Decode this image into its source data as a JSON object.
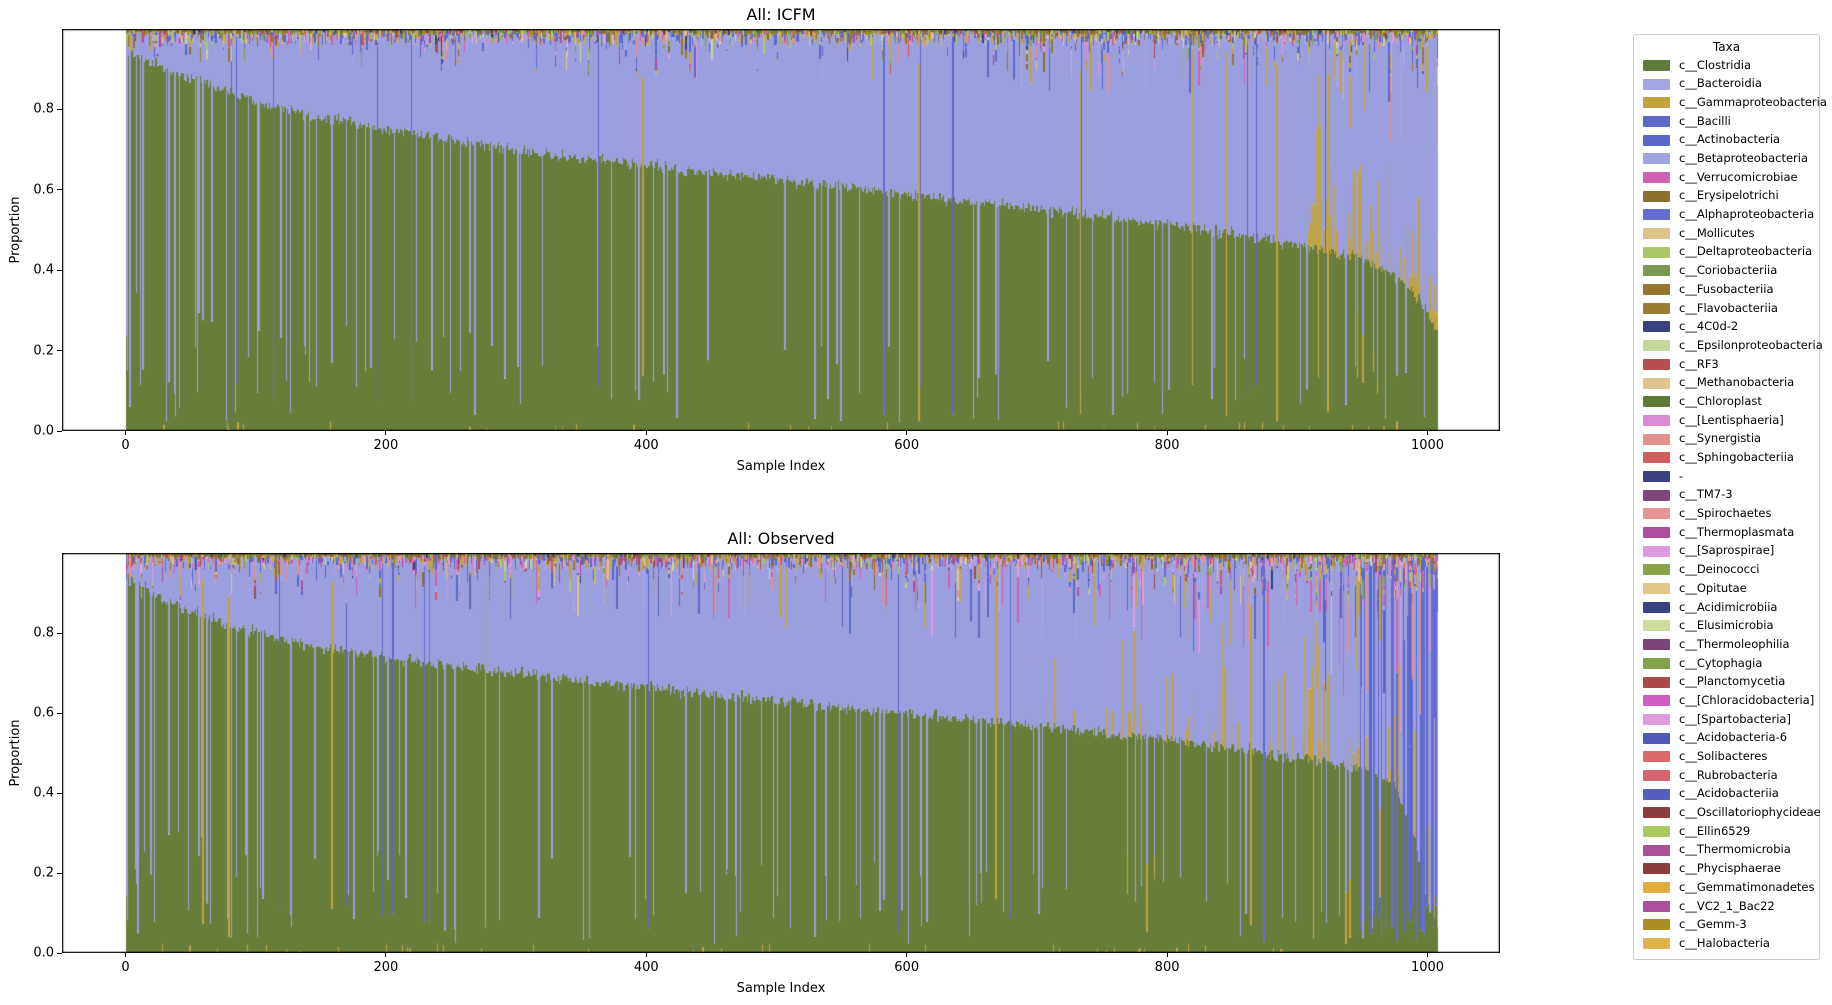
{
  "page": {
    "background": "#ffffff"
  },
  "chart_data": [
    {
      "type": "bar",
      "stacked": true,
      "title": "All: ICFM",
      "xlabel": "Sample Index",
      "ylabel": "Proportion",
      "xticks": [
        0,
        200,
        400,
        600,
        800,
        1000
      ],
      "yticks": [
        "0.0",
        "0.2",
        "0.4",
        "0.6",
        "0.8"
      ],
      "xlim": [
        -48,
        1056
      ],
      "ylim": [
        0,
        1
      ],
      "n_samples": 1008,
      "grid": false,
      "legend_position": "outside-right",
      "description": "Stacked taxa proportion bars per sample, sorted by decreasing c__Clostridia proportion; c__Bacteroidia fills most of the remainder up to ~0.97 with a noisy multi-taxa band at the top and scattered Bacteroidia/Gammaproteobacteria/Bacilli dominated outlier samples.",
      "dominant_series": [
        {
          "name": "c__Clostridia",
          "color": "#697d3b",
          "boundary_x": [
            0,
            10,
            30,
            60,
            100,
            150,
            200,
            300,
            400,
            500,
            600,
            700,
            800,
            900,
            950,
            980,
            1000,
            1007
          ],
          "boundary_y": [
            0.96,
            0.93,
            0.9,
            0.865,
            0.82,
            0.78,
            0.75,
            0.7,
            0.66,
            0.625,
            0.59,
            0.555,
            0.515,
            0.465,
            0.43,
            0.38,
            0.3,
            0.25
          ]
        },
        {
          "name": "c__Bacteroidia",
          "color": "#9c9fde",
          "top_boundary_mean": 0.965
        }
      ],
      "render_hints": {
        "seed": 101,
        "pink_weight": 1.0,
        "purple_outlier_base": 0.045,
        "purple_outlier_slope": 0.03,
        "gold_bar_p": 0.008,
        "blue_bar_p": 0.01,
        "blue_end_p": 0.03,
        "hang_p0": 0.2,
        "hang_p1": 0.15,
        "depth0": 0.05,
        "depth1": 0.1,
        "deep_t": 0.88,
        "depth_extra": 1.3,
        "gold_mid_t": 0.9,
        "gold_mid_p": 0.22,
        "left_cluster_n": 14,
        "left_cluster_p": 0.5
      }
    },
    {
      "type": "bar",
      "stacked": true,
      "title": "All: Observed",
      "xlabel": "Sample Index",
      "ylabel": "Proportion",
      "xticks": [
        0,
        200,
        400,
        600,
        800,
        1000
      ],
      "yticks": [
        "0.0",
        "0.2",
        "0.4",
        "0.6",
        "0.8"
      ],
      "xlim": [
        -48,
        1056
      ],
      "ylim": [
        0,
        1
      ],
      "n_samples": 1008,
      "grid": false,
      "legend_position": "outside-right",
      "description": "Observed stacked taxa proportions per sample, sorted by decreasing c__Clostridia; noisier than ICFM with more pink/magenta (Verrucomicrobiae, [Saprospirae], Thermoplasmata) streaks in the top band; Clostridia collapses to near zero for the last ~20 samples where Bacilli/Bacteroidia/Gammaproteobacteria dominate.",
      "dominant_series": [
        {
          "name": "c__Clostridia",
          "color": "#697d3b",
          "boundary_x": [
            0,
            10,
            30,
            60,
            100,
            150,
            200,
            300,
            400,
            500,
            600,
            700,
            800,
            900,
            950,
            975,
            990,
            1000,
            1007
          ],
          "boundary_y": [
            0.96,
            0.92,
            0.88,
            0.84,
            0.8,
            0.765,
            0.74,
            0.7,
            0.665,
            0.63,
            0.6,
            0.57,
            0.535,
            0.49,
            0.46,
            0.42,
            0.28,
            0.12,
            0.06
          ]
        },
        {
          "name": "c__Bacteroidia",
          "color": "#9c9fde",
          "top_boundary_mean": 0.955
        }
      ],
      "render_hints": {
        "seed": 202,
        "pink_weight": 2.4,
        "purple_outlier_base": 0.05,
        "purple_outlier_slope": 0.05,
        "gold_bar_p": 0.009,
        "blue_bar_p": 0.012,
        "blue_end_p": 0.28,
        "hang_p0": 0.28,
        "hang_p1": 0.22,
        "depth0": 0.08,
        "depth1": 0.16,
        "deep_t": 0.85,
        "depth_extra": 1.8,
        "gold_mid_t": 0.7,
        "gold_mid_p": 0.14,
        "left_cluster_n": 14,
        "left_cluster_p": 0.45
      }
    }
  ],
  "legend": {
    "title": "Taxa",
    "items": [
      {
        "label": "c__Clostridia",
        "color": "#5e7b3c"
      },
      {
        "label": "c__Bacteroidia",
        "color": "#a3a6df"
      },
      {
        "label": "c__Gammaproteobacteria",
        "color": "#c2a33c"
      },
      {
        "label": "c__Bacilli",
        "color": "#5a68cb"
      },
      {
        "label": "c__Actinobacteria",
        "color": "#5a66c9"
      },
      {
        "label": "c__Betaproteobacteria",
        "color": "#a0a5e1"
      },
      {
        "label": "c__Verrucomicrobiae",
        "color": "#cf63b2"
      },
      {
        "label": "c__Erysipelotrichi",
        "color": "#8a6f2d"
      },
      {
        "label": "c__Alphaproteobacteria",
        "color": "#666cd1"
      },
      {
        "label": "c__Mollicutes",
        "color": "#ddc28a"
      },
      {
        "label": "c__Deltaproteobacteria",
        "color": "#a9c968"
      },
      {
        "label": "c__Coriobacteriia",
        "color": "#7a9851"
      },
      {
        "label": "c__Fusobacteriia",
        "color": "#977730"
      },
      {
        "label": "c__Flavobacteriia",
        "color": "#9a7c33"
      },
      {
        "label": "c__4C0d-2",
        "color": "#394180"
      },
      {
        "label": "c__Epsilonproteobacteria",
        "color": "#c4d89b"
      },
      {
        "label": "c__RF3",
        "color": "#b34f4f"
      },
      {
        "label": "c__Methanobacteria",
        "color": "#dfc48d"
      },
      {
        "label": "c__Chloroplast",
        "color": "#5d7a39"
      },
      {
        "label": "c__[Lentisphaeria]",
        "color": "#d98bd3"
      },
      {
        "label": "c__Synergistia",
        "color": "#e39090"
      },
      {
        "label": "c__Sphingobacteriia",
        "color": "#d25c5c"
      },
      {
        "label": "-",
        "color": "#3a4180"
      },
      {
        "label": "c__TM7-3",
        "color": "#7f467b"
      },
      {
        "label": "c__Spirochaetes",
        "color": "#e89494"
      },
      {
        "label": "c__Thermoplasmata",
        "color": "#ad4f9e"
      },
      {
        "label": "c__[Saprospirae]",
        "color": "#de9ade"
      },
      {
        "label": "c__Deinococci",
        "color": "#89a347"
      },
      {
        "label": "c__Opitutae",
        "color": "#e2c687"
      },
      {
        "label": "c__Acidimicrobiia",
        "color": "#3a4180"
      },
      {
        "label": "c__Elusimicrobia",
        "color": "#cbdc9c"
      },
      {
        "label": "c__Thermoleophilia",
        "color": "#7c4479"
      },
      {
        "label": "c__Cytophagia",
        "color": "#84a24a"
      },
      {
        "label": "c__Planctomycetia",
        "color": "#ab4a4a"
      },
      {
        "label": "c__[Chloracidobacteria]",
        "color": "#cc5fc0"
      },
      {
        "label": "c__[Spartobacteria]",
        "color": "#dc9ddc"
      },
      {
        "label": "c__Acidobacteria-6",
        "color": "#4e59b5"
      },
      {
        "label": "c__Solibacteres",
        "color": "#dd6a6a"
      },
      {
        "label": "c__Rubrobacteria",
        "color": "#d66470"
      },
      {
        "label": "c__Acidobacteriia",
        "color": "#5560bd"
      },
      {
        "label": "c__Oscillatoriophycideae",
        "color": "#8c3d3d"
      },
      {
        "label": "c__Ellin6529",
        "color": "#aac860"
      },
      {
        "label": "c__Thermomicrobia",
        "color": "#ad509a"
      },
      {
        "label": "c__Phycisphaerae",
        "color": "#8c3d3d"
      },
      {
        "label": "c__Gemmatimonadetes",
        "color": "#e0ad3f"
      },
      {
        "label": "c__VC2_1_Bac22",
        "color": "#ad4f9e"
      },
      {
        "label": "c__Gemm-3",
        "color": "#ab8c25"
      },
      {
        "label": "c__Halobacteria",
        "color": "#dfb44a"
      }
    ]
  }
}
